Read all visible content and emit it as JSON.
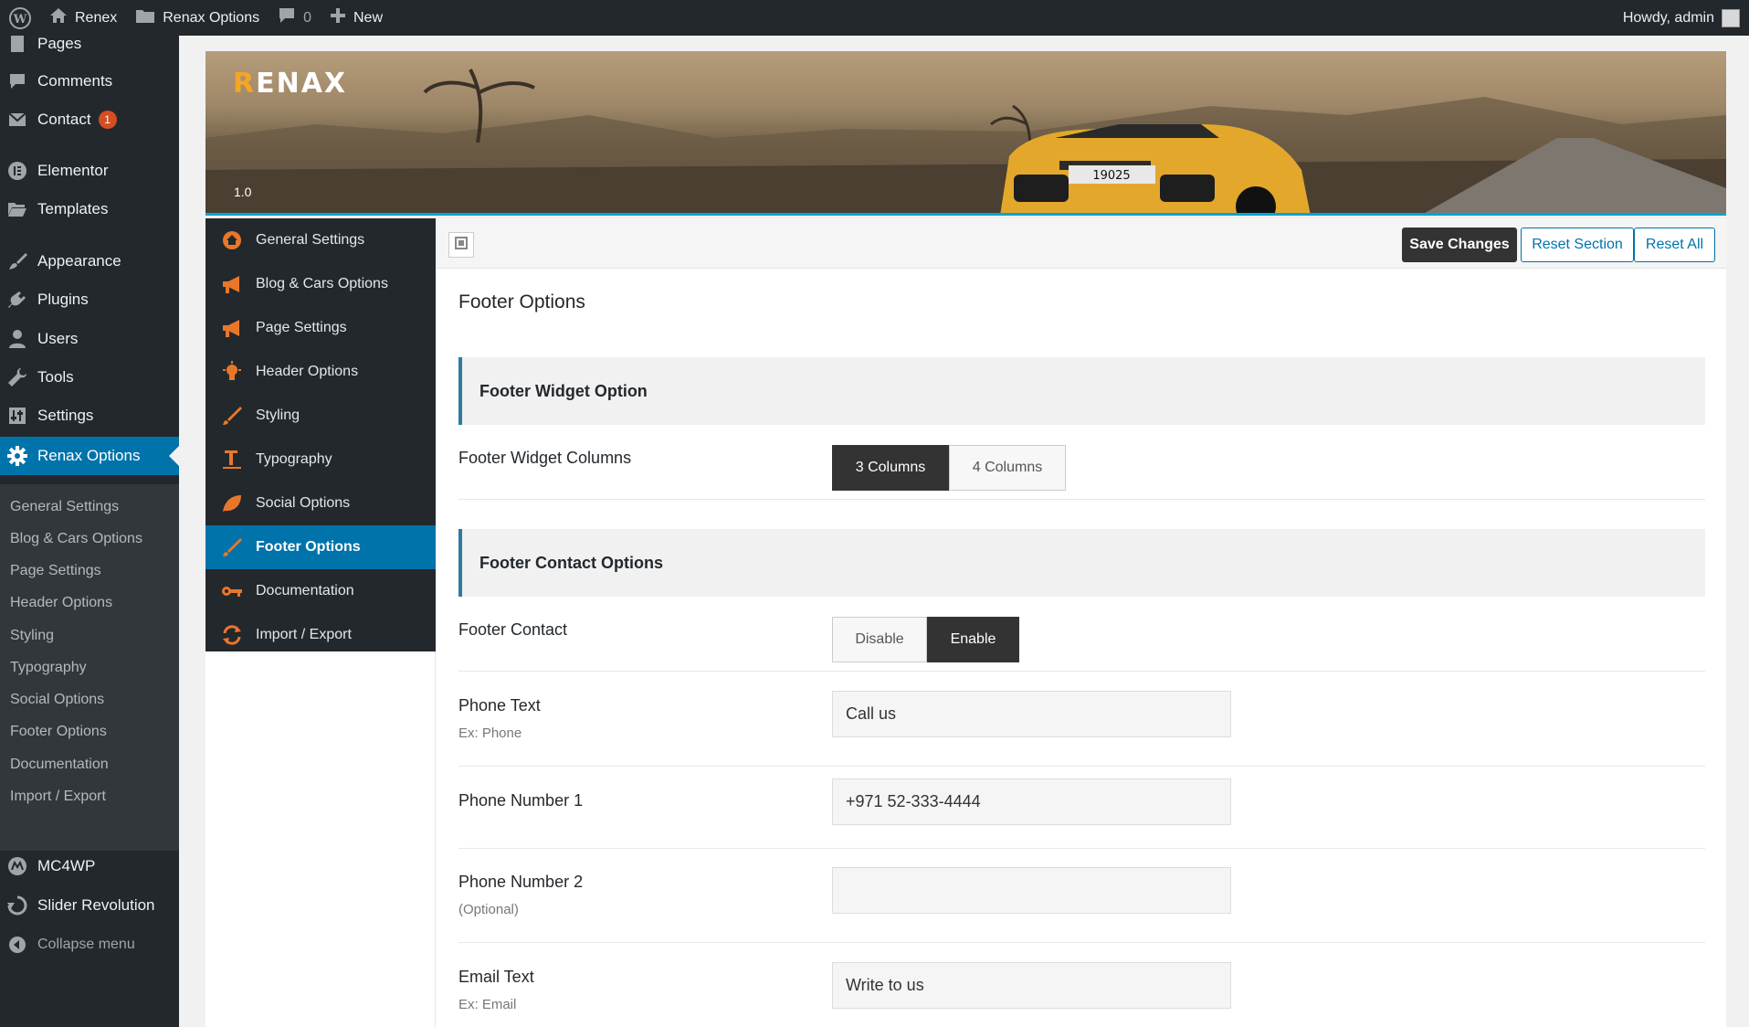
{
  "adminbar": {
    "site_name": "Renex",
    "options_label": "Renax Options",
    "comments_count": "0",
    "new_label": "New",
    "howdy": "Howdy, admin"
  },
  "menu": {
    "pages": "Pages",
    "comments": "Comments",
    "contact": "Contact",
    "contact_badge": "1",
    "elementor": "Elementor",
    "templates": "Templates",
    "appearance": "Appearance",
    "plugins": "Plugins",
    "users": "Users",
    "tools": "Tools",
    "settings": "Settings",
    "renax_options": "Renax Options",
    "mc4wp": "MC4WP",
    "slider_revolution": "Slider Revolution",
    "collapse": "Collapse menu"
  },
  "submenu": [
    "General Settings",
    "Blog & Cars Options",
    "Page Settings",
    "Header Options",
    "Styling",
    "Typography",
    "Social Options",
    "Footer Options",
    "Documentation",
    "Import / Export"
  ],
  "banner": {
    "logo_first": "R",
    "logo_rest": "ENAX",
    "version": "1.0",
    "plate": "19025"
  },
  "options_nav": [
    "General Settings",
    "Blog & Cars Options",
    "Page Settings",
    "Header Options",
    "Styling",
    "Typography",
    "Social Options",
    "Footer Options",
    "Documentation",
    "Import / Export"
  ],
  "toolbar": {
    "save": "Save Changes",
    "reset_section": "Reset Section",
    "reset_all": "Reset All"
  },
  "main": {
    "title": "Footer Options",
    "widget_group": "Footer Widget Option",
    "widget_columns_label": "Footer Widget Columns",
    "col3": "3 Columns",
    "col4": "4 Columns",
    "contact_group": "Footer Contact Options",
    "footer_contact_label": "Footer Contact",
    "disable": "Disable",
    "enable": "Enable",
    "phone_text_label": "Phone Text",
    "phone_text_desc": "Ex: Phone",
    "phone_text_value": "Call us",
    "phone1_label": "Phone Number 1",
    "phone1_value": "+971 52-333-4444",
    "phone2_label": "Phone Number 2",
    "phone2_desc": "(Optional)",
    "phone2_value": "",
    "email_text_label": "Email Text",
    "email_text_desc": "Ex: Email",
    "email_text_value": "Write to us"
  },
  "colors": {
    "accent": "#0073aa",
    "brand_orange": "#e9772a",
    "dark": "#23282d"
  }
}
